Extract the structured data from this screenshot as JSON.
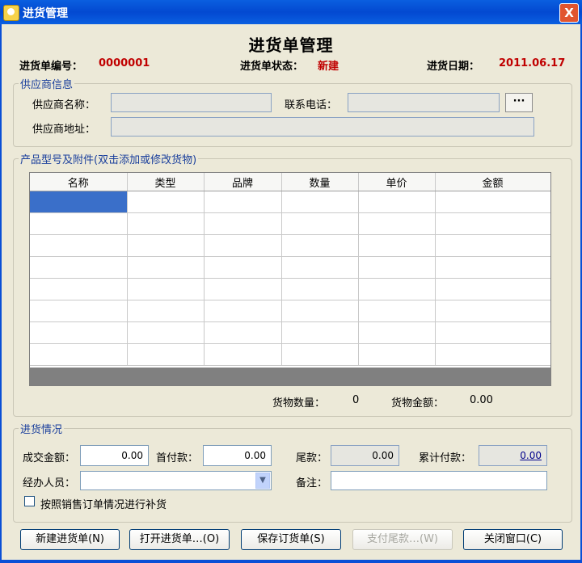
{
  "window": {
    "title": "进货管理",
    "close": "X"
  },
  "form_title": "进货单管理",
  "header": {
    "order_no_label": "进货单编号：",
    "order_no": "0000001",
    "status_label": "进货单状态：",
    "status": "新建",
    "date_label": "进货日期：",
    "date": "2011.06.17"
  },
  "supplier": {
    "legend": "供应商信息",
    "name_label": "供应商名称：",
    "name_value": "",
    "phone_label": "联系电话：",
    "phone_value": "",
    "browse_label": "···",
    "address_label": "供应商地址：",
    "address_value": ""
  },
  "products": {
    "legend": "产品型号及附件(双击添加或修改货物)",
    "columns": [
      "名称",
      "类型",
      "品牌",
      "数量",
      "单价",
      "金额"
    ],
    "row_count": 8,
    "qty_label": "货物数量：",
    "qty": "0",
    "amount_label": "货物金额：",
    "amount": "0.00"
  },
  "purchase": {
    "legend": "进货情况",
    "deal_label": "成交金额：",
    "deal": "0.00",
    "first_label": "首付款：",
    "first": "0.00",
    "balance_label": "尾款：",
    "balance": "0.00",
    "total_label": "累计付款：",
    "total": "0.00",
    "handler_label": "经办人员：",
    "handler": "",
    "remark_label": "备注：",
    "remark": "",
    "checkbox_label": "按照销售订单情况进行补货"
  },
  "buttons": {
    "new": "新建进货单(N)",
    "open": "打开进货单…(O)",
    "save": "保存订货单(S)",
    "pay": "支付尾款…(W)",
    "close": "关闭窗口(C)"
  },
  "colors": {
    "accent": "#0a5fe0",
    "status_red": "#c00000",
    "selected_cell": "#3a6fc9"
  }
}
